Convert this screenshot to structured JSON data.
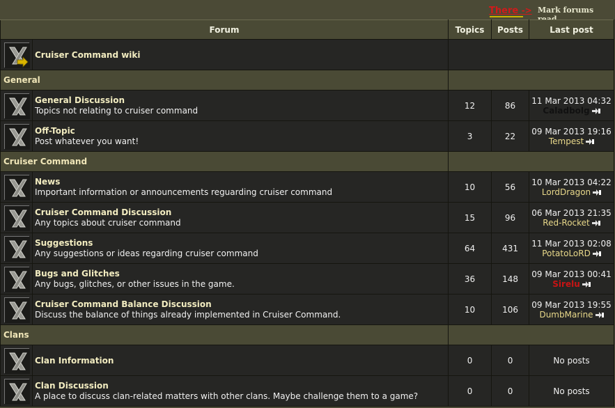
{
  "top": {
    "there_label": "There",
    "there_arrow": "->",
    "mark_read": "Mark forums read"
  },
  "columns": {
    "forum": "Forum",
    "topics": "Topics",
    "posts": "Posts",
    "last_post": "Last post"
  },
  "wiki": {
    "name": "Cruiser Command wiki"
  },
  "categories": {
    "general": "General",
    "cruiser": "Cruiser Command",
    "clans": "Clans"
  },
  "forums": {
    "general_discussion": {
      "name": "General Discussion",
      "desc": "Topics not relating to cruiser command",
      "topics": "12",
      "posts": "86",
      "date": "11 Mar 2013 04:32",
      "user": "Caladbolg",
      "user_color": "#111111"
    },
    "off_topic": {
      "name": "Off-Topic",
      "desc": "Post whatever you want!",
      "topics": "3",
      "posts": "22",
      "date": "09 Mar 2013 19:16",
      "user": "Tempest",
      "user_color": "#e8d88a"
    },
    "news": {
      "name": "News",
      "desc": "Important information or announcements reguarding cruiser command",
      "topics": "10",
      "posts": "56",
      "date": "10 Mar 2013 04:22",
      "user": "LordDragon",
      "user_color": "#e8d88a"
    },
    "cc_discussion": {
      "name": "Cruiser Command Discussion",
      "desc": "Any topics about cruiser command",
      "topics": "15",
      "posts": "96",
      "date": "06 Mar 2013 21:35",
      "user": "Red-Rocket",
      "user_color": "#e8d88a"
    },
    "suggestions": {
      "name": "Suggestions",
      "desc": "Any suggestions or ideas regarding cruiser command",
      "topics": "64",
      "posts": "431",
      "date": "11 Mar 2013 02:08",
      "user": "PotatoLoRD",
      "user_color": "#e8d88a"
    },
    "bugs": {
      "name": "Bugs and Glitches",
      "desc": "Any bugs, glitches, or other issues in the game.",
      "topics": "36",
      "posts": "148",
      "date": "09 Mar 2013 00:41",
      "user": "Sirelu",
      "user_color": "#c81414"
    },
    "balance": {
      "name": "Cruiser Command Balance Discussion",
      "desc": "Discuss the balance of things already implemented in Cruiser Command.",
      "topics": "10",
      "posts": "106",
      "date": "09 Mar 2013 19:55",
      "user": "DumbMarine",
      "user_color": "#e8d88a"
    },
    "clan_info": {
      "name": "Clan Information",
      "desc": "",
      "topics": "0",
      "posts": "0",
      "no_posts": "No posts"
    },
    "clan_discussion": {
      "name": "Clan Discussion",
      "desc": "A place to discuss clan-related matters with other clans. Maybe challenge them to a game?",
      "topics": "0",
      "posts": "0",
      "no_posts": "No posts"
    }
  }
}
